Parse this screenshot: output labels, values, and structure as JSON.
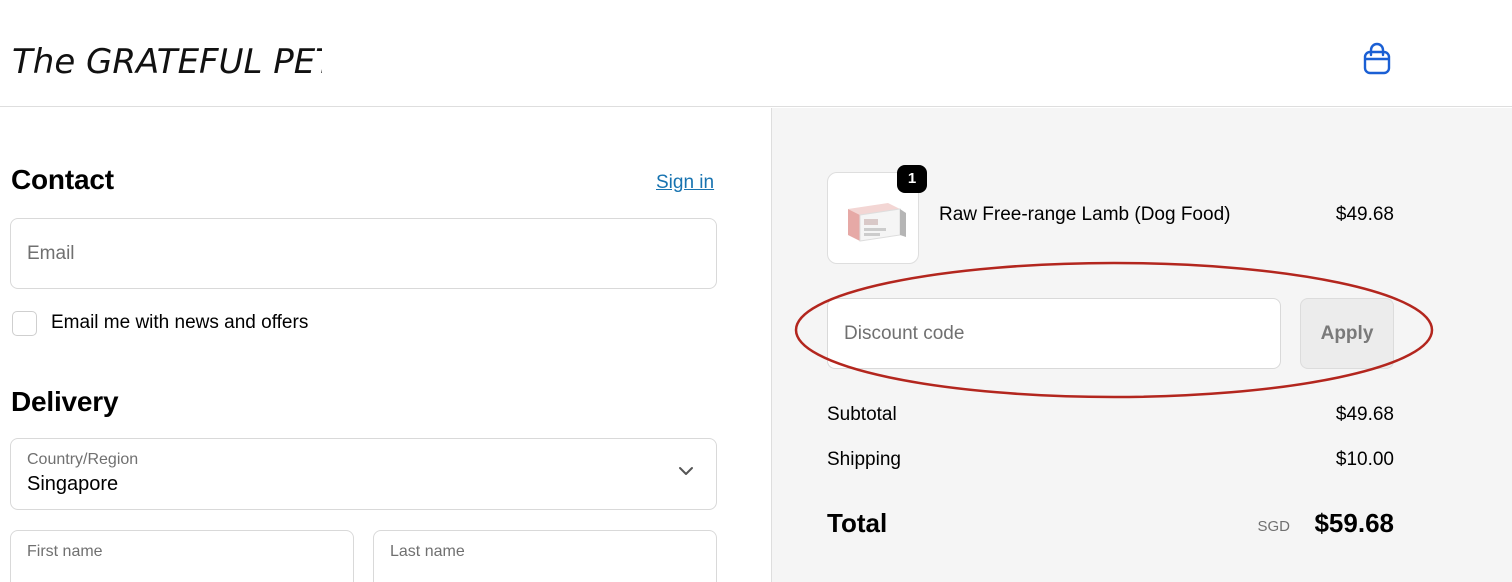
{
  "header": {
    "logo_text": "The GRATEFUL PET",
    "cart_icon": "shopping-bag-icon",
    "accent_color": "#1a5fd4"
  },
  "contact": {
    "title": "Contact",
    "sign_in_label": "Sign in",
    "email_placeholder": "Email",
    "newsletter_label": "Email me with news and offers"
  },
  "delivery": {
    "title": "Delivery",
    "country_label": "Country/Region",
    "country_value": "Singapore",
    "first_name_label": "First name",
    "last_name_label": "Last name"
  },
  "order": {
    "item": {
      "quantity": "1",
      "name": "Raw Free-range Lamb (Dog Food)",
      "price": "$49.68"
    },
    "discount_placeholder": "Discount code",
    "apply_label": "Apply",
    "subtotal_label": "Subtotal",
    "subtotal_value": "$49.68",
    "shipping_label": "Shipping",
    "shipping_value": "$10.00",
    "total_label": "Total",
    "currency": "SGD",
    "total_value": "$59.68"
  },
  "annotation_color": "#b3261e"
}
